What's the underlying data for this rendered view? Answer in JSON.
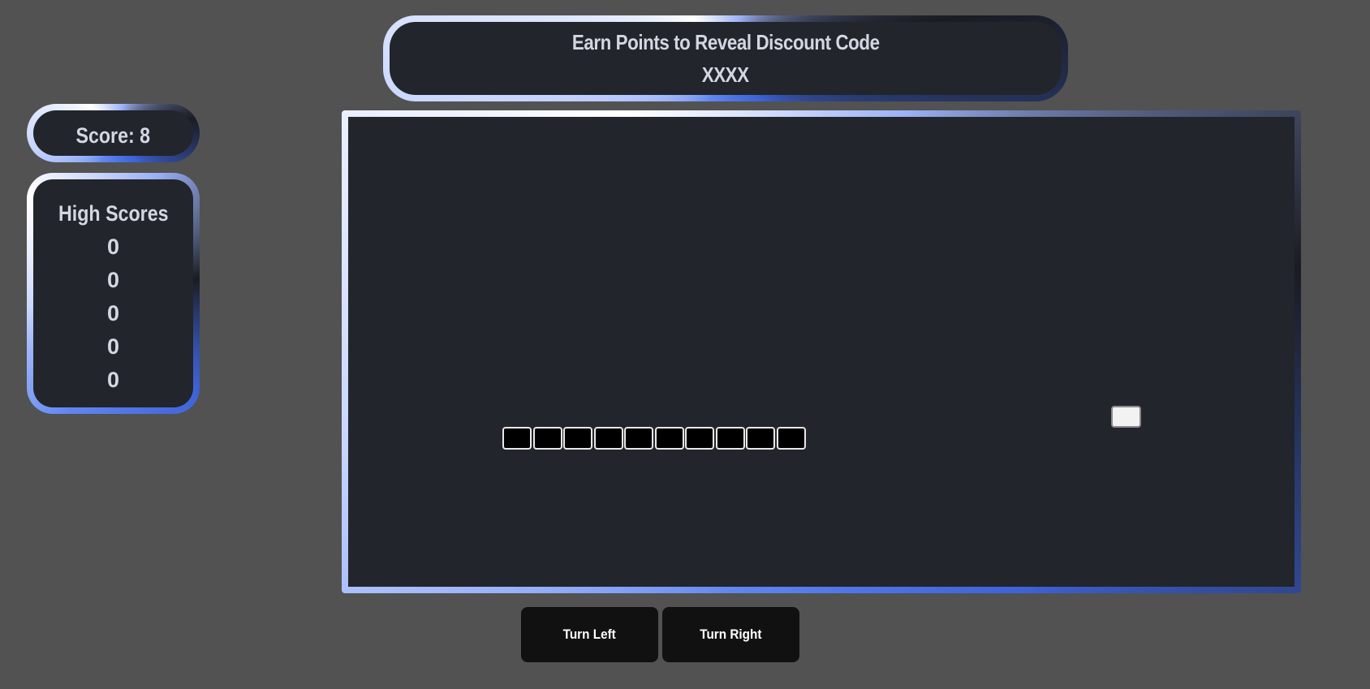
{
  "header": {
    "title": "Earn Points to Reveal Discount Code",
    "code": "XXXX"
  },
  "score": {
    "label": "Score: 8",
    "value": 8
  },
  "high_scores": {
    "title": "High Scores",
    "items": [
      "0",
      "0",
      "0",
      "0",
      "0"
    ]
  },
  "game": {
    "snake_length": 10,
    "snake_direction": "horizontal",
    "food_present": true
  },
  "controls": {
    "turn_left": "Turn Left",
    "turn_right": "Turn Right"
  },
  "colors": {
    "page_background": "#525252",
    "panel_background": "#22252b",
    "accent": "#5f86f0",
    "text": "#d3d7e2",
    "button_background": "#111111"
  }
}
